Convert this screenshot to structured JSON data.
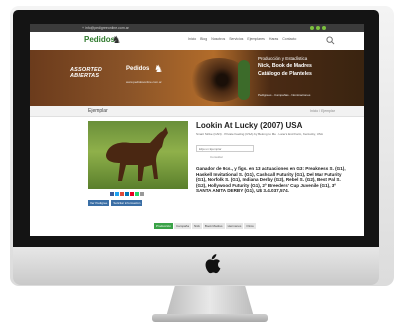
{
  "topbar": {
    "contact": "+ info@pedigreeonline.com.ar"
  },
  "nav": {
    "logo": "Pedidos",
    "menu": [
      "Inicio",
      "Blog",
      "Nosotros",
      "Servicios",
      "Ejemplares",
      "Haras",
      "Contacto"
    ]
  },
  "banner": {
    "line1": "ASSORTED",
    "line2": "ABIERTAS",
    "logo": "Pedidos",
    "web": "www.pedidosonline.com.ar",
    "right1": "Producción y Estadística",
    "right2": "Nick, Book de Madres",
    "right3": "Catálogo de Planteles",
    "right4": "Pedigrees - Campañas - Nominaciones"
  },
  "section": {
    "title": "Ejemplar",
    "crumb": "Inicio / Ejemplar"
  },
  "horse": {
    "name": "Lookin At Lucky (2007) USA",
    "subinfo": "Smart Strike (CAN) · Private Feeling (USA) by Belong to Me · Lane's End Farm, Kentucky, USA",
    "select_placeholder": "Elija un Ejemplar",
    "consult": "Consultar",
    "description": "Ganador de 9cs., y figs. en 13 actuaciones en G3: Preakness S. (G1), Haskell Invitational S. (G1), Cashcall Futurity (G1), Del Mar Futurity (G1), Norfolk S. (G1), Indiana Derby (G2), Rebel S. (G2), Best Pal S. (G2), Hollywood Futurity (G1), 2º Breeders' Cup Juvenile (G1), 3º SANTA ANITA DERBY (G1), U$ 3.4.037,574."
  },
  "buttons": [
    "Ver Pedigree",
    "Solicitar información"
  ],
  "tabs": [
    "Producción",
    "Campaña",
    "Nick",
    "Book Madres",
    "Hermanos",
    "Otros"
  ]
}
